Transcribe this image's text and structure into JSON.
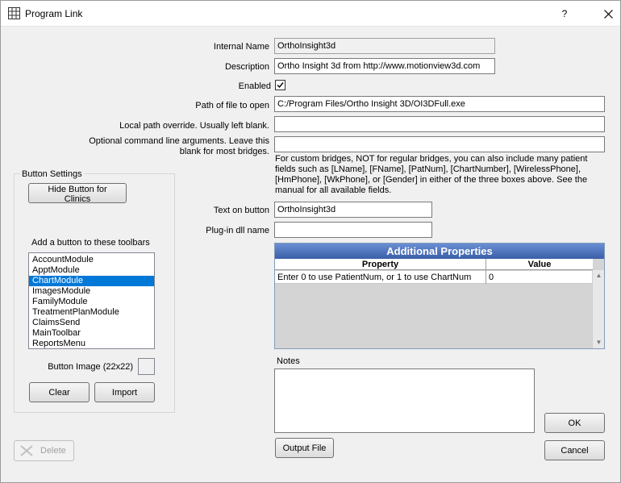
{
  "window": {
    "title": "Program Link",
    "help": "?",
    "close": "✕"
  },
  "form": {
    "internal_name_label": "Internal Name",
    "internal_name_value": "OrthoInsight3d",
    "description_label": "Description",
    "description_value": "Ortho Insight 3d from http://www.motionview3d.com",
    "enabled_label": "Enabled",
    "enabled_check": "✓",
    "path_label": "Path of file to open",
    "path_value": "C:/Program Files/Ortho Insight 3D/OI3DFull.exe",
    "local_path_label": "Local path override.  Usually left blank.",
    "local_path_value": "",
    "cmd_label": "Optional command line arguments.  Leave this blank for most bridges.",
    "cmd_value": "",
    "info_text": "For custom bridges, NOT for regular bridges, you can also include many patient fields such as [LName], [FName], [PatNum], [ChartNumber], [WirelessPhone], [HmPhone], [WkPhone], or [Gender] in either of the three boxes above. See the manual for all available fields.",
    "text_on_button_label": "Text on button",
    "text_on_button_value": "OrthoInsight3d",
    "plugin_label": "Plug-in dll name",
    "plugin_value": ""
  },
  "button_settings": {
    "title": "Button Settings",
    "hide_button": "Hide Button for Clinics",
    "toolbars_label": "Add a button to these toolbars",
    "toolbars": [
      {
        "label": "AccountModule",
        "selected": false
      },
      {
        "label": "ApptModule",
        "selected": false
      },
      {
        "label": "ChartModule",
        "selected": true
      },
      {
        "label": "ImagesModule",
        "selected": false
      },
      {
        "label": "FamilyModule",
        "selected": false
      },
      {
        "label": "TreatmentPlanModule",
        "selected": false
      },
      {
        "label": "ClaimsSend",
        "selected": false
      },
      {
        "label": "MainToolbar",
        "selected": false
      },
      {
        "label": "ReportsMenu",
        "selected": false
      }
    ],
    "image_label": "Button Image (22x22)",
    "clear": "Clear",
    "import": "Import"
  },
  "properties": {
    "title": "Additional Properties",
    "col_property": "Property",
    "col_value": "Value",
    "rows": [
      {
        "property": "Enter 0 to use PatientNum, or 1 to use ChartNum",
        "value": "0"
      }
    ]
  },
  "notes": {
    "label": "Notes",
    "value": ""
  },
  "actions": {
    "delete": "Delete",
    "output_file": "Output File",
    "ok": "OK",
    "cancel": "Cancel"
  },
  "colors": {
    "selection": "#0078d7",
    "grid_title": "#3a5ea8"
  }
}
